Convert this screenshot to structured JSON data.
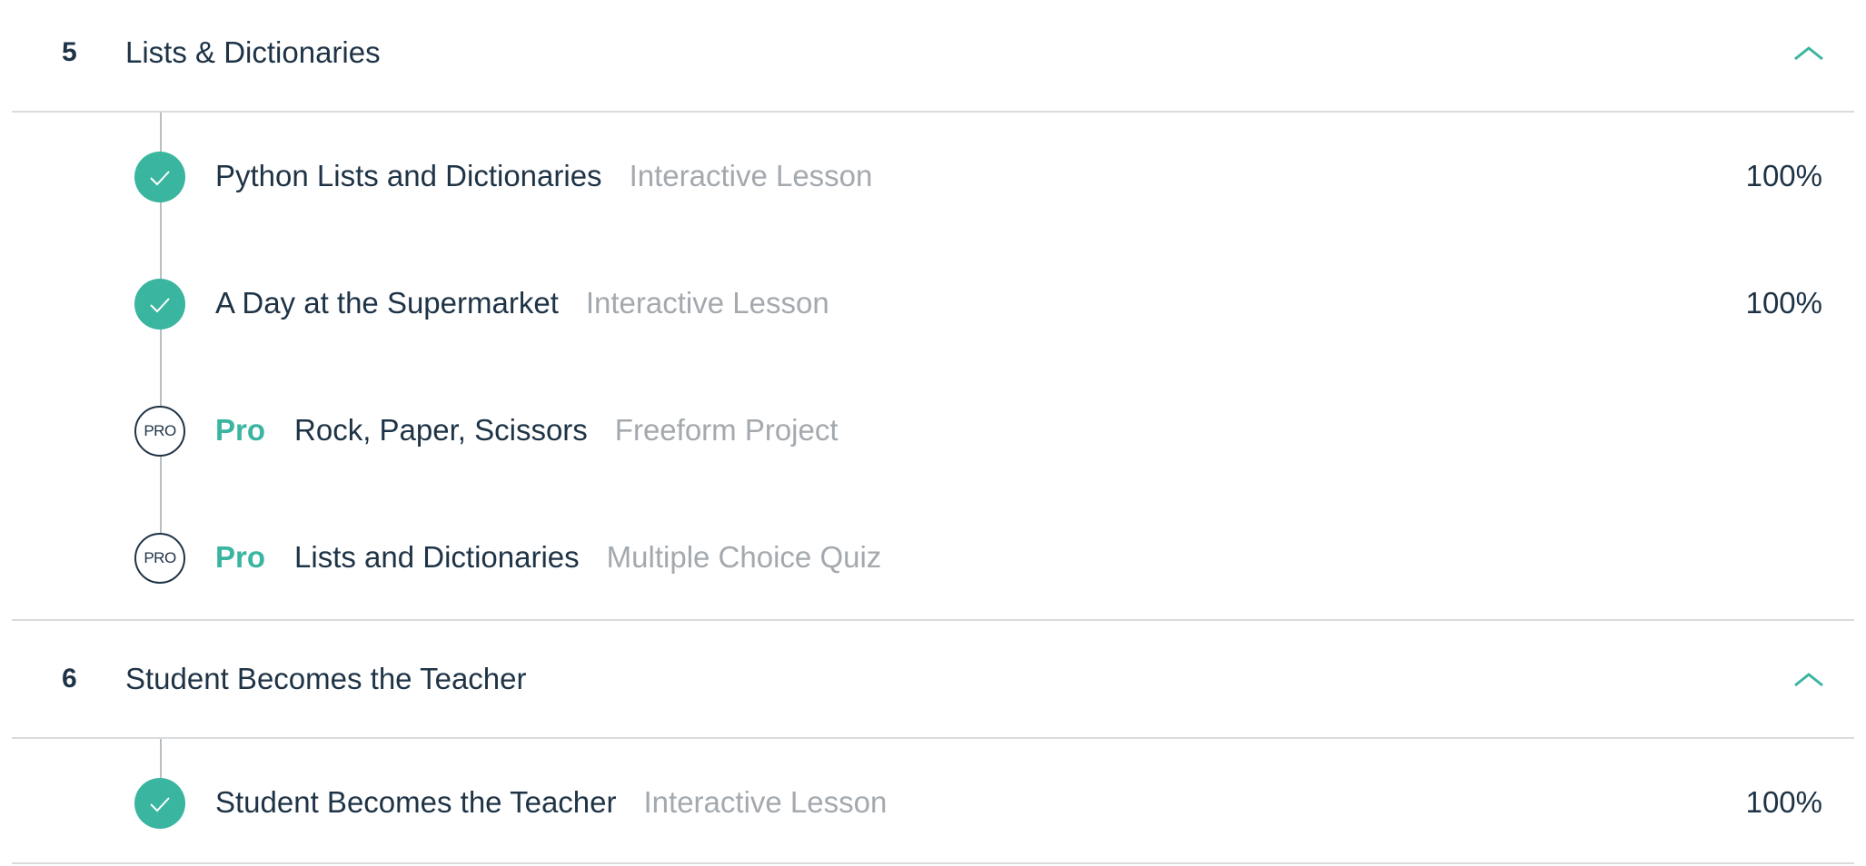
{
  "colors": {
    "accent": "#3ab5a0",
    "text_primary": "#1e3346",
    "text_muted": "#a3a9ae",
    "divider": "#d9dcdf"
  },
  "sections": [
    {
      "number": "5",
      "title": "Lists & Dictionaries",
      "toggle_icon": "chevron-up-icon",
      "lessons": [
        {
          "status_icon": "check-icon",
          "pro": false,
          "title": "Python Lists and Dictionaries",
          "type": "Interactive Lesson",
          "progress": "100%"
        },
        {
          "status_icon": "check-icon",
          "pro": false,
          "title": "A Day at the Supermarket",
          "type": "Interactive Lesson",
          "progress": "100%"
        },
        {
          "status_icon": "pro-badge-icon",
          "badge_text": "PRO",
          "pro": true,
          "pro_label": "Pro",
          "title": "Rock, Paper, Scissors",
          "type": "Freeform Project",
          "progress": ""
        },
        {
          "status_icon": "pro-badge-icon",
          "badge_text": "PRO",
          "pro": true,
          "pro_label": "Pro",
          "title": "Lists and Dictionaries",
          "type": "Multiple Choice Quiz",
          "progress": ""
        }
      ]
    },
    {
      "number": "6",
      "title": "Student Becomes the Teacher",
      "toggle_icon": "chevron-up-icon",
      "lessons": [
        {
          "status_icon": "check-icon",
          "pro": false,
          "title": "Student Becomes the Teacher",
          "type": "Interactive Lesson",
          "progress": "100%"
        }
      ]
    }
  ]
}
